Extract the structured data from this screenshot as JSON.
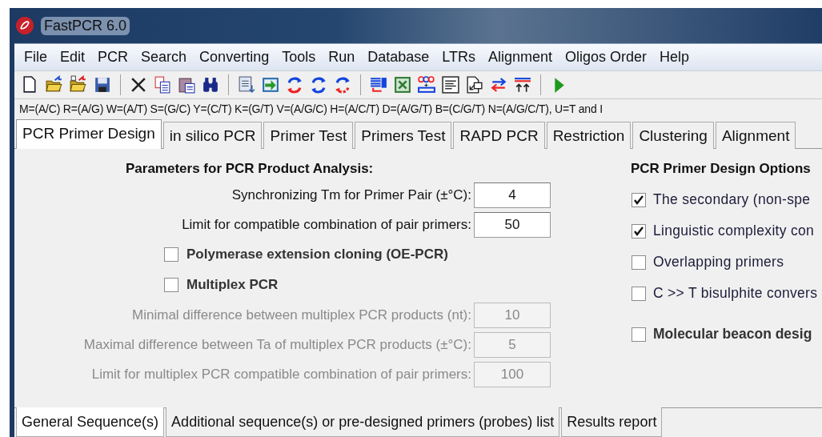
{
  "window": {
    "title": "FastPCR 6.0"
  },
  "menu": [
    {
      "label": "File"
    },
    {
      "label": "Edit"
    },
    {
      "label": "PCR"
    },
    {
      "label": "Search"
    },
    {
      "label": "Converting"
    },
    {
      "label": "Tools"
    },
    {
      "label": "Run"
    },
    {
      "label": "Database"
    },
    {
      "label": "LTRs"
    },
    {
      "label": "Alignment"
    },
    {
      "label": "Oligos Order"
    },
    {
      "label": "Help"
    }
  ],
  "iupac_line": "M=(A/C) R=(A/G) W=(A/T) S=(G/C) Y=(C/T) K=(G/T) V=(A/G/C) H=(A/C/T) D=(A/G/T) B=(C/G/T) N=(A/G/C/T), U=T and I",
  "tabs": [
    {
      "label": "PCR Primer Design",
      "selected": true
    },
    {
      "label": "in silico PCR",
      "selected": false
    },
    {
      "label": "Primer Test",
      "selected": false
    },
    {
      "label": "Primers Test",
      "selected": false
    },
    {
      "label": "RAPD PCR",
      "selected": false
    },
    {
      "label": "Restriction",
      "selected": false
    },
    {
      "label": "Clustering",
      "selected": false
    },
    {
      "label": "Alignment",
      "selected": false
    }
  ],
  "product_analysis": {
    "title": "Parameters for PCR Product Analysis:",
    "items": [
      {
        "kind": "field",
        "label": "Synchronizing Tm for Primer Pair (±°C):",
        "value": "4",
        "disabled": false
      },
      {
        "kind": "field",
        "label": "Limit for compatible combination of pair primers:",
        "value": "50",
        "disabled": false
      },
      {
        "kind": "checkbox",
        "label": "Polymerase extension cloning (OE-PCR)",
        "checked": false
      },
      {
        "kind": "checkbox",
        "label": "Multiplex PCR",
        "checked": false
      },
      {
        "kind": "field",
        "label": "Minimal difference between multiplex PCR products (nt):",
        "value": "10",
        "disabled": true
      },
      {
        "kind": "field",
        "label": "Maximal difference between Ta of multiplex PCR products (±°C):",
        "value": "5",
        "disabled": true
      },
      {
        "kind": "field",
        "label": "Limit for multiplex PCR compatible combination of pair primers:",
        "value": "100",
        "disabled": true
      }
    ]
  },
  "design_options": {
    "title": "PCR Primer Design Options",
    "options": [
      {
        "label": "The secondary (non-spe",
        "checked": true,
        "bold": false
      },
      {
        "label": "Linguistic complexity con",
        "checked": true,
        "bold": false
      },
      {
        "label": "Overlapping primers",
        "checked": false,
        "bold": false
      },
      {
        "label": "C >> T bisulphite convers",
        "checked": false,
        "bold": false
      },
      {
        "label": "Molecular beacon desig",
        "checked": false,
        "bold": true
      }
    ]
  },
  "bottom_tabs": [
    {
      "label": "General Sequence(s)",
      "selected": true
    },
    {
      "label": "Additional sequence(s) or pre-designed primers (probes) list",
      "selected": false
    },
    {
      "label": "Results report",
      "selected": false
    }
  ]
}
